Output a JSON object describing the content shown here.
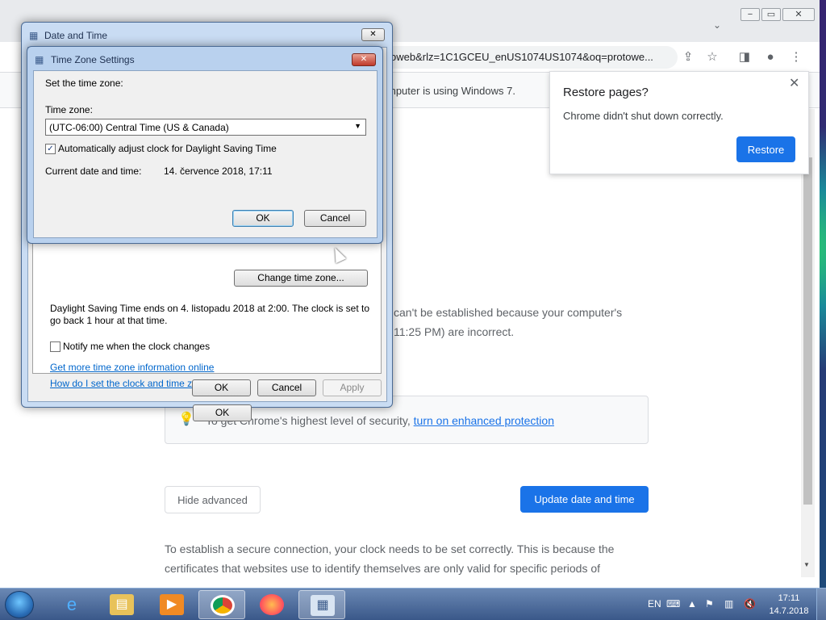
{
  "chrome": {
    "window_controls": {
      "minimize": "−",
      "maximize": "▭",
      "close": "✕"
    },
    "tab_dropdown": "⌄",
    "omnibox_text": "oweb&rlz=1C1GCEU_enUS1074US1074&oq=protowe...",
    "toolbar_icons": [
      "share-icon",
      "star-icon",
      "side-panel-icon",
      "profile-icon",
      "menu-icon"
    ],
    "infobar_text": "mputer is using Windows 7.",
    "page": {
      "error_line_1": "can't be established because your computer's",
      "error_line_2": "11:25 PM) are incorrect.",
      "security_tip": "To get Chrome's highest level of security, ",
      "security_link": "turn on enhanced protection",
      "hide_advanced": "Hide advanced",
      "update_button": "Update date and time",
      "body_line_1": "To establish a secure connection, your clock needs to be set correctly. This is because the",
      "body_line_2": "certificates that websites use to identify themselves are only valid for specific periods of"
    },
    "restore_popup": {
      "title": "Restore pages?",
      "message": "Chrome didn't shut down correctly.",
      "button": "Restore",
      "close": "✕"
    }
  },
  "date_time_dialog": {
    "title": "Date and Time",
    "close": "✕",
    "change_tz_button": "Change time zone...",
    "dst_line_1": "Daylight Saving Time ends on 4. listopadu 2018 at 2:00. The clock is set to",
    "dst_line_2": "go back 1 hour at that time.",
    "notify_label": "Notify me when the clock changes",
    "notify_checked": false,
    "link_more_info": "Get more time zone information online",
    "link_how_to": "How do I set the clock and time zone?",
    "ok": "OK",
    "cancel": "Cancel",
    "apply": "Apply"
  },
  "tz_dialog": {
    "title": "Time Zone Settings",
    "close": "✕",
    "set_label": "Set the time zone:",
    "tz_label": "Time zone:",
    "tz_value": "(UTC-06:00) Central Time (US & Canada)",
    "dst_label": "Automatically adjust clock for Daylight Saving Time",
    "dst_checked": true,
    "current_label": "Current date and time:",
    "current_value": "14. července 2018, 17:11",
    "ok": "OK",
    "cancel": "Cancel"
  },
  "taskbar": {
    "apps": [
      "internet-explorer-icon",
      "file-explorer-icon",
      "media-player-icon",
      "chrome-icon",
      "firefox-icon",
      "date-time-icon"
    ],
    "tray_lang": "EN",
    "tray_icons": [
      "keyboard-icon",
      "show-hidden-icon",
      "action-center-icon",
      "network-icon",
      "volume-icon"
    ],
    "clock_time": "17:11",
    "clock_date": "14.7.2018"
  },
  "colors": {
    "chrome_blue": "#1a73e8",
    "taskbar": "#3a5889",
    "dialog_frame": "#c9dcf3"
  }
}
